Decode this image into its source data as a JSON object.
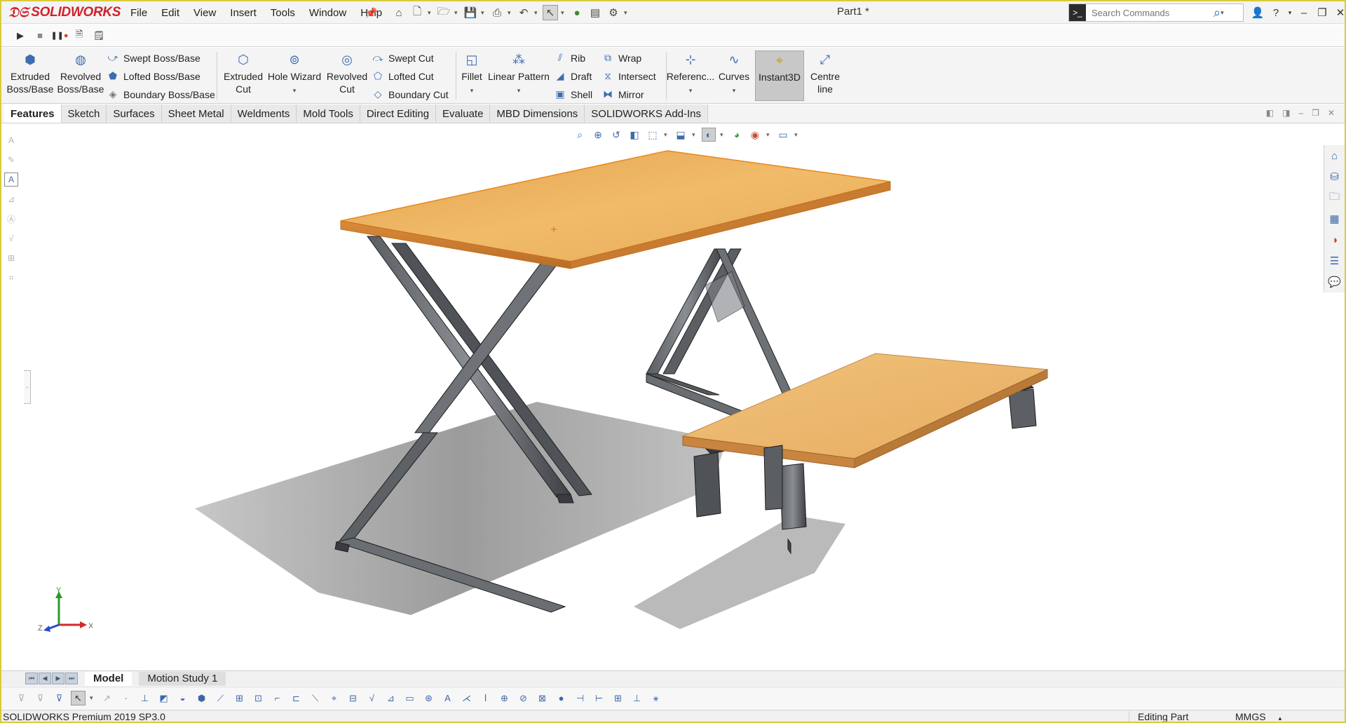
{
  "app": {
    "brand": "SOLIDWORKS",
    "document_title": "Part1 *"
  },
  "menu": [
    "File",
    "Edit",
    "View",
    "Insert",
    "Tools",
    "Window",
    "Help"
  ],
  "search": {
    "placeholder": "Search Commands"
  },
  "ribbon": {
    "extruded_boss": "Extruded Boss/Base",
    "revolved_boss": "Revolved Boss/Base",
    "swept_boss": "Swept Boss/Base",
    "lofted_boss": "Lofted Boss/Base",
    "boundary_boss": "Boundary Boss/Base",
    "extruded_cut": "Extruded Cut",
    "hole_wizard": "Hole Wizard",
    "revolved_cut": "Revolved Cut",
    "swept_cut": "Swept Cut",
    "lofted_cut": "Lofted Cut",
    "boundary_cut": "Boundary Cut",
    "fillet": "Fillet",
    "linear_pattern": "Linear Pattern",
    "rib": "Rib",
    "draft": "Draft",
    "shell": "Shell",
    "wrap": "Wrap",
    "intersect": "Intersect",
    "mirror": "Mirror",
    "reference": "Referenc...",
    "curves": "Curves",
    "instant3d": "Instant3D",
    "centreline": "Centre line"
  },
  "tabs": [
    "Features",
    "Sketch",
    "Surfaces",
    "Sheet Metal",
    "Weldments",
    "Mold Tools",
    "Direct Editing",
    "Evaluate",
    "MBD Dimensions",
    "SOLIDWORKS Add-Ins"
  ],
  "active_tab": "Features",
  "triad": {
    "x": "X",
    "y": "Y",
    "z": "Z"
  },
  "bottom_tabs": {
    "model": "Model",
    "motion": "Motion Study 1"
  },
  "status": {
    "product": "SOLIDWORKS Premium 2019 SP3.0",
    "mode": "Editing Part",
    "units": "MMGS"
  },
  "colors": {
    "brand_red": "#d4202a",
    "wood": "#e9ad58",
    "steel": "#4a4d52",
    "selection_orange": "#f08a1e"
  }
}
